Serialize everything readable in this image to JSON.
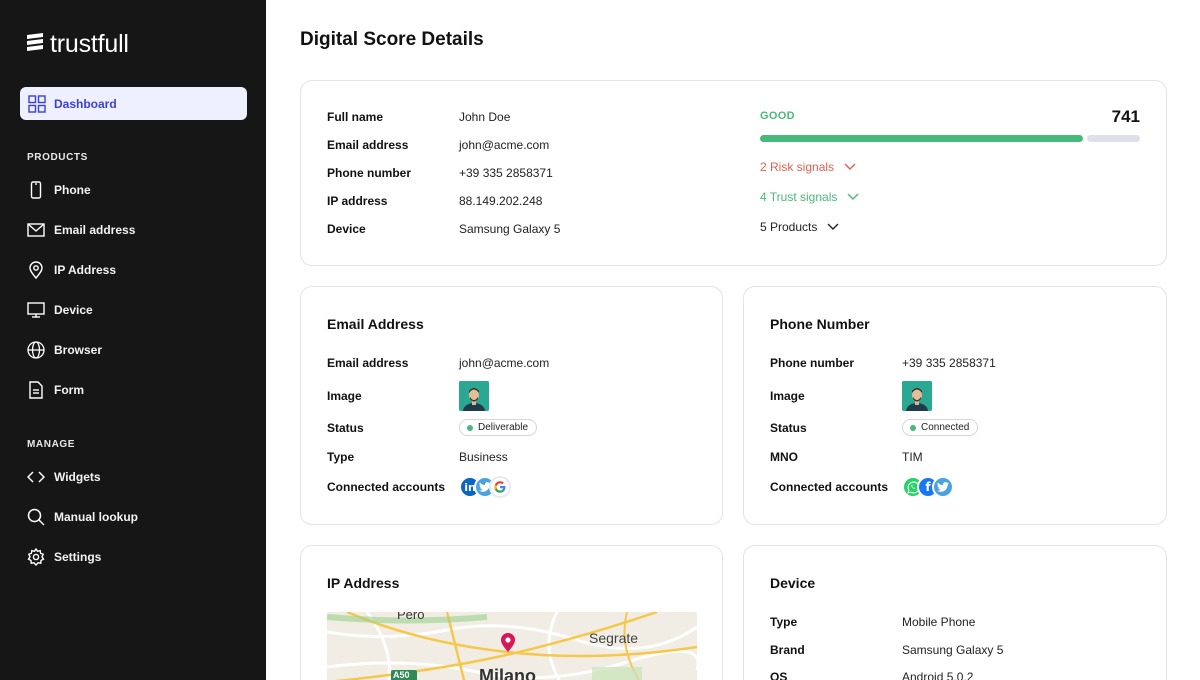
{
  "app": {
    "name": "trustfull"
  },
  "sidebar": {
    "active": {
      "label": "Dashboard",
      "icon": "grid-icon"
    },
    "products_title": "PRODUCTS",
    "products": [
      {
        "label": "Phone",
        "icon": "phone-icon"
      },
      {
        "label": "Email address",
        "icon": "mail-icon"
      },
      {
        "label": "IP Address",
        "icon": "location-pin-icon"
      },
      {
        "label": "Device",
        "icon": "monitor-icon"
      },
      {
        "label": "Browser",
        "icon": "globe-icon"
      },
      {
        "label": "Form",
        "icon": "document-icon"
      }
    ],
    "manage_title": "MANAGE",
    "manage": [
      {
        "label": "Widgets",
        "icon": "code-icon"
      },
      {
        "label": "Manual lookup",
        "icon": "search-icon"
      },
      {
        "label": "Settings",
        "icon": "gear-icon"
      }
    ]
  },
  "page": {
    "title": "Digital Score Details"
  },
  "summary": {
    "fields": [
      {
        "key": "Full name",
        "value": "John Doe"
      },
      {
        "key": "Email address",
        "value": "john@acme.com"
      },
      {
        "key": "Phone number",
        "value": "+39 335 2858371"
      },
      {
        "key": "IP address",
        "value": "88.149.202.248"
      },
      {
        "key": "Device",
        "value": "Samsung Galaxy 5"
      }
    ],
    "score_label": "GOOD",
    "score": "741",
    "score_fill_fraction": 0.85,
    "signals": [
      {
        "label": "2 Risk signals",
        "color": "#e0604e"
      },
      {
        "label": "4 Trust signals",
        "color": "#4bb978"
      },
      {
        "label": "5 Products",
        "color": "#222222"
      }
    ]
  },
  "email_card": {
    "title": "Email Address",
    "email_key": "Email address",
    "email_value": "john@acme.com",
    "image_key": "Image",
    "status_key": "Status",
    "status_value": "Deliverable",
    "type_key": "Type",
    "type_value": "Business",
    "accounts_key": "Connected accounts",
    "accounts": [
      "linkedin-icon",
      "twitter-icon",
      "google-icon"
    ]
  },
  "phone_card": {
    "title": "Phone Number",
    "phone_key": "Phone number",
    "phone_value": "+39 335 2858371",
    "image_key": "Image",
    "status_key": "Status",
    "status_value": "Connected",
    "mno_key": "MNO",
    "mno_value": "TIM",
    "accounts_key": "Connected accounts",
    "accounts": [
      "whatsapp-icon",
      "facebook-icon",
      "twitter-icon"
    ]
  },
  "ip_card": {
    "title": "IP Address",
    "map_labels": {
      "top": "Pero",
      "right": "Segrate",
      "city": "Milano",
      "road": "A50"
    }
  },
  "device_card": {
    "title": "Device",
    "fields": [
      {
        "key": "Type",
        "value": "Mobile Phone"
      },
      {
        "key": "Brand",
        "value": "Samsung Galaxy 5"
      },
      {
        "key": "OS",
        "value": "Android 5.0.2"
      }
    ]
  },
  "colors": {
    "sidebar_bg": "#161616",
    "accent": "#3b3fd6",
    "good": "#47b979",
    "risk": "#e0604e"
  }
}
